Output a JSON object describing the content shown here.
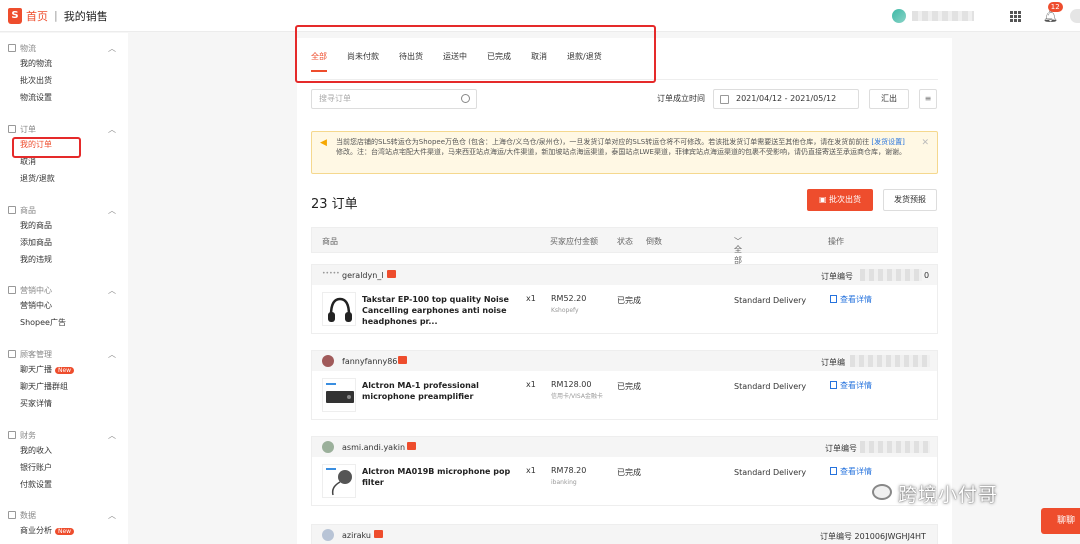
{
  "header": {
    "logo": "S",
    "home": "首页",
    "separator": "|",
    "current": "我的销售",
    "notification_count": "12"
  },
  "sidebar": {
    "sections": [
      {
        "title": "物流",
        "items": [
          "我的物流",
          "批次出货",
          "物流设置"
        ]
      },
      {
        "title": "订单",
        "items": [
          "我的订单",
          "取消",
          "退货/退款"
        ]
      },
      {
        "title": "商品",
        "items": [
          "我的商品",
          "添加商品",
          "我的违规"
        ]
      },
      {
        "title": "营销中心",
        "items": [
          "营销中心",
          "Shopee广告"
        ]
      },
      {
        "title": "顾客管理",
        "items": [
          "聊天广播",
          "聊天广播群组",
          "买家详情"
        ]
      },
      {
        "title": "财务",
        "items": [
          "我的收入",
          "银行账户",
          "付款设置"
        ]
      },
      {
        "title": "数据",
        "items": [
          "商业分析"
        ]
      }
    ],
    "new_tag": "New"
  },
  "tabs": [
    "全部",
    "尚未付款",
    "待出货",
    "运送中",
    "已完成",
    "取消",
    "退款/退货"
  ],
  "filters": {
    "search_placeholder": "搜寻订单",
    "date_label": "订单成立时间",
    "date_range": "2021/04/12 - 2021/05/12",
    "export": "汇出",
    "menu": "≡"
  },
  "notice": {
    "text1": "当前您店铺的SLS转运仓为Shopee万色仓 (包含：上海仓/义乌仓/泉州仓)，一旦发货订单对应的SLS转运仓将不可修改。若该批发货订单需要送至其他仓库，请在发货前前往 ",
    "link": "[发货设置]",
    "text2": " 修改。注：台湾站点宅配大件渠道，马来西亚站点海运/大件渠道，新加坡站点海运渠道，泰国站点LWE渠道，菲律宾站点海运渠道的包裹不受影响，请仍直接寄送至承运商仓库，谢谢。",
    "close": "✕"
  },
  "summary": {
    "count": "23 订单",
    "batch_ship": "批次出货",
    "pre_ship": "发货预报"
  },
  "table_header": {
    "product": "商品",
    "amount": "买家应付金额",
    "status": "状态",
    "countdown": "倒数",
    "logistics": "全部物流商",
    "action": "操作"
  },
  "orders": [
    {
      "buyer": "geraldyn_l",
      "order_label": "订单编号",
      "order_suffix": "0",
      "product": "Takstar EP-100 top quality Noise Cancelling earphones anti noise headphones pr...",
      "qty": "x1",
      "price": "RM52.20",
      "payment": "Kshopefy",
      "status": "已完成",
      "shipping": "Standard Delivery",
      "view": "查看详情"
    },
    {
      "buyer": "fannyfanny86",
      "order_label": "订单编",
      "order_suffix": "",
      "product": "Alctron MA-1 professional microphone preamplifier",
      "qty": "x1",
      "price": "RM128.00",
      "payment": "信用卡/VISA金融卡",
      "status": "已完成",
      "shipping": "Standard Delivery",
      "view": "查看详情"
    },
    {
      "buyer": "asmi.andi.yakin",
      "order_label": "订单编号",
      "order_suffix": "",
      "product": "Alctron MA019B microphone pop filter",
      "qty": "x1",
      "price": "RM78.20",
      "payment": "ibanking",
      "status": "已完成",
      "shipping": "Standard Delivery",
      "view": "查看详情"
    },
    {
      "buyer": "aziraku",
      "order_label": "订单编号 201006JWGHJ4HT",
      "order_suffix": "",
      "product": "",
      "qty": "",
      "price": "",
      "payment": "",
      "status": "",
      "shipping": "",
      "view": ""
    }
  ],
  "watermark": "跨境小付哥",
  "chat_button": "聊聊",
  "colors": {
    "brand": "#ee4d2d",
    "link": "#2673dd",
    "highlight_box": "#e52a2a"
  }
}
